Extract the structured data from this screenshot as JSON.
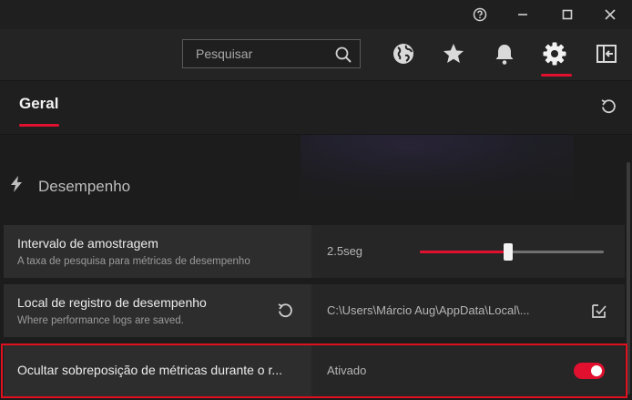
{
  "window_controls": {
    "help": "help-icon",
    "minimize": "minimize-icon",
    "maximize": "maximize-icon",
    "close": "close-icon"
  },
  "toolbar": {
    "search_placeholder": "Pesquisar",
    "icons": [
      "globe-icon",
      "star-icon",
      "bell-icon",
      "gear-icon",
      "sidebar-exit-icon"
    ],
    "active_icon": "gear-icon"
  },
  "tabs": {
    "active_label": "Geral"
  },
  "section": {
    "title": "Desempenho",
    "icon": "lightning-icon"
  },
  "settings": {
    "sampling": {
      "title": "Intervalo de amostragem",
      "description": "A taxa de pesquisa para métricas de desempenho",
      "value": "2.5seg",
      "slider_fraction": 0.48
    },
    "log_location": {
      "title": "Local de registro de desempenho",
      "description": "Where performance logs are saved.",
      "value": "C:\\Users\\Márcio Aug\\AppData\\Local\\..."
    },
    "hide_overlay": {
      "title": "Ocultar sobreposição de métricas durante o r...",
      "value": "Ativado",
      "toggle_on": true
    }
  },
  "colors": {
    "accent": "#e0102e",
    "background": "#1c1c1c",
    "row": "#2d2d2d"
  }
}
